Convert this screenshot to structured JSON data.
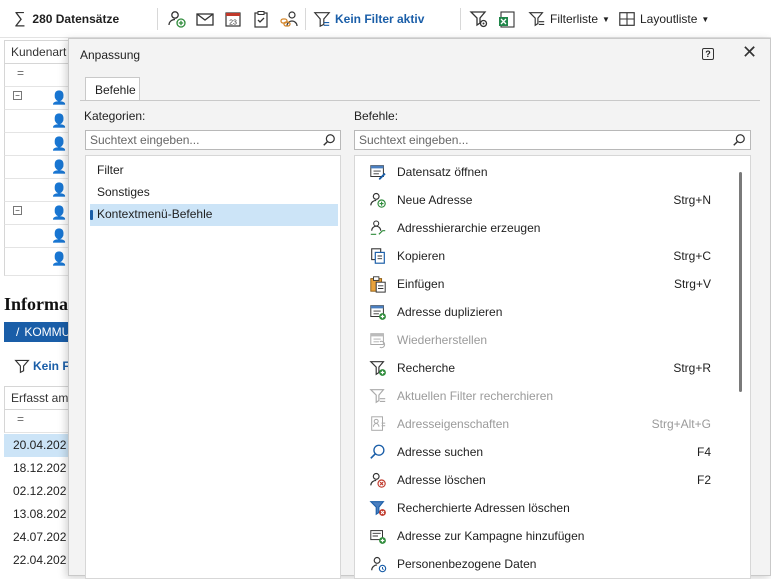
{
  "toolbar": {
    "record_count": "280 Datensätze",
    "filter_status": "Kein Filter aktiv",
    "filterliste": "Filterliste",
    "layoutliste": "Layoutliste"
  },
  "background": {
    "column1_header": "Kundenart",
    "section_title": "Informa",
    "tab_label": "KOMMU",
    "filter_status": "Kein F",
    "date_header": "Erfasst am",
    "dates": [
      "20.04.202",
      "18.12.202",
      "02.12.202",
      "13.08.202",
      "24.07.202",
      "22.04.202"
    ]
  },
  "dialog": {
    "title": "Anpassung",
    "tab": "Befehle",
    "categories_label": "Kategorien:",
    "commands_label": "Befehle:",
    "search_placeholder": "Suchtext eingeben...",
    "categories": [
      {
        "label": "Filter"
      },
      {
        "label": "Sonstiges"
      },
      {
        "label": "Kontextmenü-Befehle",
        "selected": true
      }
    ],
    "commands": [
      {
        "label": "Datensatz öffnen",
        "shortcut": "",
        "enabled": true,
        "icon": "open-record-icon"
      },
      {
        "label": "Neue Adresse",
        "shortcut": "Strg+N",
        "enabled": true,
        "icon": "new-address-icon"
      },
      {
        "label": "Adresshierarchie erzeugen",
        "shortcut": "",
        "enabled": true,
        "icon": "hierarchy-icon"
      },
      {
        "label": "Kopieren",
        "shortcut": "Strg+C",
        "enabled": true,
        "icon": "copy-icon"
      },
      {
        "label": "Einfügen",
        "shortcut": "Strg+V",
        "enabled": true,
        "icon": "paste-icon"
      },
      {
        "label": "Adresse duplizieren",
        "shortcut": "",
        "enabled": true,
        "icon": "duplicate-icon"
      },
      {
        "label": "Wiederherstellen",
        "shortcut": "",
        "enabled": false,
        "icon": "restore-icon"
      },
      {
        "label": "Recherche",
        "shortcut": "Strg+R",
        "enabled": true,
        "icon": "filter-add-icon"
      },
      {
        "label": "Aktuellen Filter recherchieren",
        "shortcut": "",
        "enabled": false,
        "icon": "filter-icon"
      },
      {
        "label": "Adresseigenschaften",
        "shortcut": "Strg+Alt+G",
        "enabled": false,
        "icon": "properties-icon"
      },
      {
        "label": "Adresse suchen",
        "shortcut": "F4",
        "enabled": true,
        "icon": "search-icon"
      },
      {
        "label": "Adresse löschen",
        "shortcut": "F2",
        "enabled": true,
        "icon": "delete-address-icon"
      },
      {
        "label": "Recherchierte Adressen löschen",
        "shortcut": "",
        "enabled": true,
        "icon": "filter-delete-icon"
      },
      {
        "label": "Adresse zur Kampagne hinzufügen",
        "shortcut": "",
        "enabled": true,
        "icon": "campaign-icon"
      },
      {
        "label": "Personenbezogene Daten",
        "shortcut": "",
        "enabled": true,
        "icon": "personal-data-icon"
      }
    ]
  },
  "colors": {
    "accent": "#1a5ea8",
    "selected": "#cce4f7",
    "disabled": "#9a9a9a"
  }
}
